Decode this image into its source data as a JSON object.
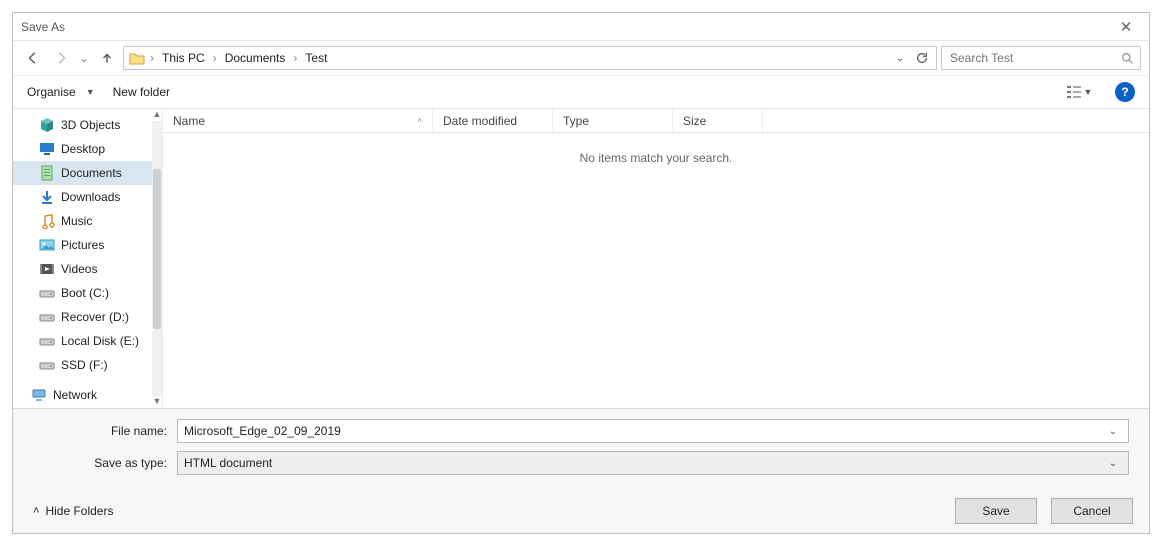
{
  "window": {
    "title": "Save As"
  },
  "breadcrumb": {
    "parts": [
      "This PC",
      "Documents",
      "Test"
    ]
  },
  "search": {
    "placeholder": "Search Test"
  },
  "toolbar": {
    "organise": "Organise",
    "new_folder": "New folder"
  },
  "tree": {
    "items": [
      {
        "label": "3D Objects",
        "icon": "cube",
        "selected": false
      },
      {
        "label": "Desktop",
        "icon": "desktop",
        "selected": false
      },
      {
        "label": "Documents",
        "icon": "document",
        "selected": true
      },
      {
        "label": "Downloads",
        "icon": "download",
        "selected": false
      },
      {
        "label": "Music",
        "icon": "music",
        "selected": false
      },
      {
        "label": "Pictures",
        "icon": "pictures",
        "selected": false
      },
      {
        "label": "Videos",
        "icon": "videos",
        "selected": false
      },
      {
        "label": "Boot (C:)",
        "icon": "drive",
        "selected": false
      },
      {
        "label": "Recover (D:)",
        "icon": "drive",
        "selected": false
      },
      {
        "label": "Local Disk (E:)",
        "icon": "drive",
        "selected": false
      },
      {
        "label": "SSD (F:)",
        "icon": "drive",
        "selected": false
      }
    ],
    "network_label": "Network"
  },
  "columns": {
    "name": "Name",
    "date": "Date modified",
    "type": "Type",
    "size": "Size"
  },
  "empty_message": "No items match your search.",
  "form": {
    "name_label": "File name:",
    "name_value": "Microsoft_Edge_02_09_2019",
    "type_label": "Save as type:",
    "type_value": "HTML document"
  },
  "footer": {
    "hide_folders": "Hide Folders",
    "save": "Save",
    "cancel": "Cancel"
  }
}
